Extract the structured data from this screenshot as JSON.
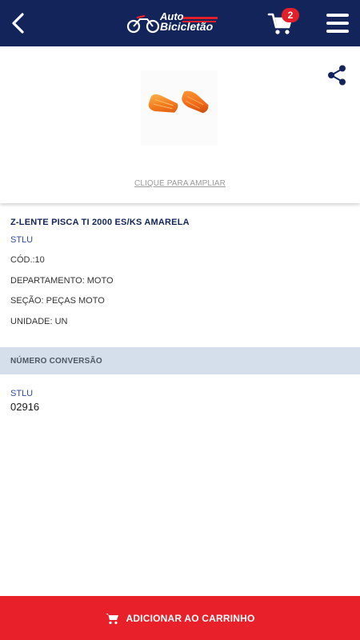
{
  "header": {
    "logo_line1": "Auto",
    "logo_line2": "Bicicletão",
    "cart_count": "2",
    "bg_color": "#12245a",
    "accent_color": "#e3202a"
  },
  "product": {
    "zoom_label": "CLIQUE PARA AMPLIAR",
    "title": "Z-LENTE PISCA TI 2000 ES/KS AMARELA",
    "brand": "STLU",
    "code": "CÓD.:10",
    "department": "DEPARTAMENTO: MOTO",
    "section": "SEÇÃO: PEÇAS MOTO",
    "unit": "UNIDADE: UN"
  },
  "conversion": {
    "title": "NÚMERO CONVERSÃO",
    "brand": "STLU",
    "number": "02916"
  },
  "footer": {
    "add_to_cart_label": "ADICIONAR AO CARRINHO",
    "button_color": "#e8202a"
  },
  "icons": [
    "back-arrow-icon",
    "motorcycle-logo-icon",
    "cart-icon",
    "menu-icon",
    "share-icon"
  ]
}
